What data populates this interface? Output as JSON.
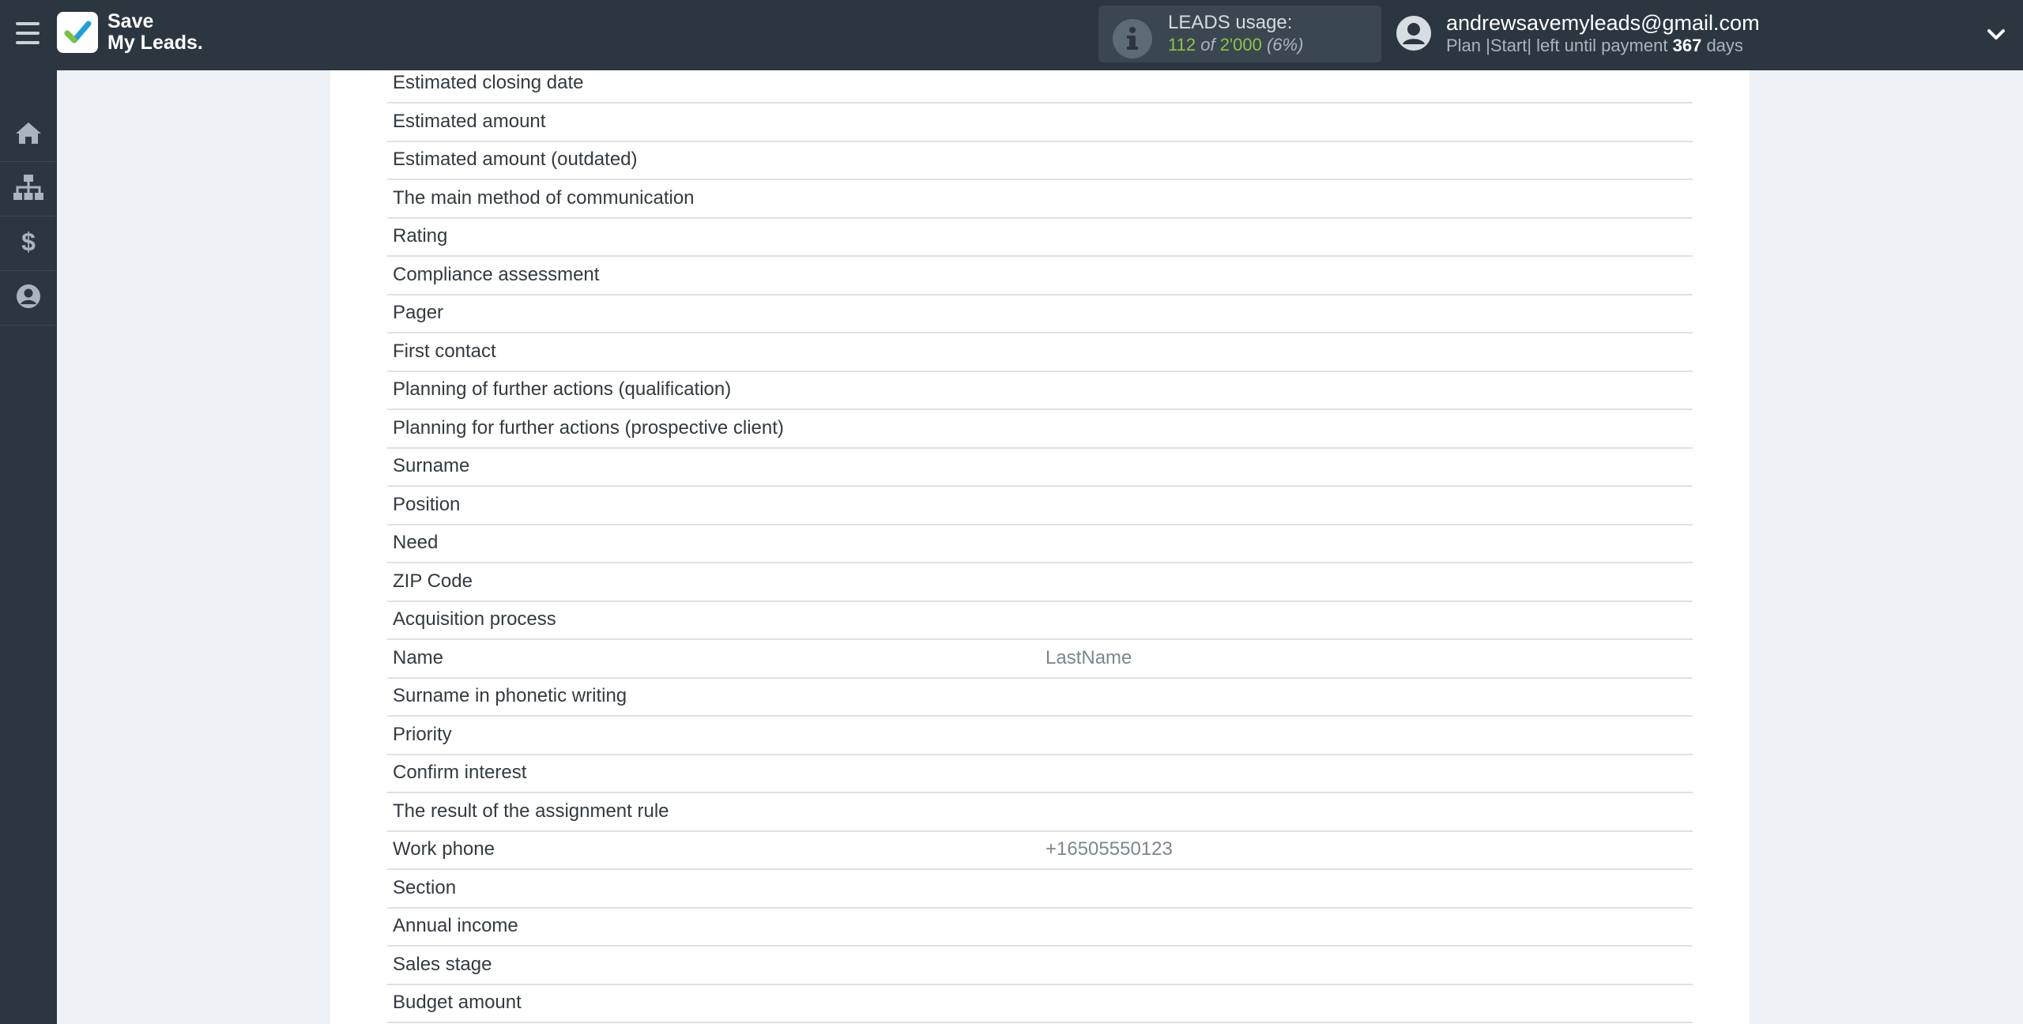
{
  "header": {
    "logo_line1": "Save",
    "logo_line2": "My Leads.",
    "leads_usage_label": "LEADS usage:",
    "leads_used": "112",
    "leads_of": "of",
    "leads_total": "2'000",
    "leads_percent": "(6%)",
    "user_email": "andrewsavemyleads@gmail.com",
    "plan_text": "Plan |Start| left until payment",
    "plan_days": "367",
    "plan_days_suffix": "days"
  },
  "sidebar": {
    "items": [
      {
        "icon": "home-icon"
      },
      {
        "icon": "sitemap-icon"
      },
      {
        "icon": "dollar-icon"
      },
      {
        "icon": "user-circle-icon"
      }
    ]
  },
  "fields": [
    {
      "label": "Estimated closing date",
      "value": ""
    },
    {
      "label": "Estimated amount",
      "value": ""
    },
    {
      "label": "Estimated amount (outdated)",
      "value": ""
    },
    {
      "label": "The main method of communication",
      "value": ""
    },
    {
      "label": "Rating",
      "value": ""
    },
    {
      "label": "Compliance assessment",
      "value": ""
    },
    {
      "label": "Pager",
      "value": ""
    },
    {
      "label": "First contact",
      "value": ""
    },
    {
      "label": "Planning of further actions (qualification)",
      "value": ""
    },
    {
      "label": "Planning for further actions (prospective client)",
      "value": ""
    },
    {
      "label": "Surname",
      "value": ""
    },
    {
      "label": "Position",
      "value": ""
    },
    {
      "label": "Need",
      "value": ""
    },
    {
      "label": "ZIP Code",
      "value": ""
    },
    {
      "label": "Acquisition process",
      "value": ""
    },
    {
      "label": "Name",
      "value": "LastName"
    },
    {
      "label": "Surname in phonetic writing",
      "value": ""
    },
    {
      "label": "Priority",
      "value": ""
    },
    {
      "label": "Confirm interest",
      "value": ""
    },
    {
      "label": "The result of the assignment rule",
      "value": ""
    },
    {
      "label": "Work phone",
      "value": "+16505550123"
    },
    {
      "label": "Section",
      "value": ""
    },
    {
      "label": "Annual income",
      "value": ""
    },
    {
      "label": "Sales stage",
      "value": ""
    },
    {
      "label": "Budget amount",
      "value": ""
    }
  ],
  "colors": {
    "topbar": "#2c3640",
    "accent_green": "#8cc63f",
    "background": "#eef1f5"
  }
}
